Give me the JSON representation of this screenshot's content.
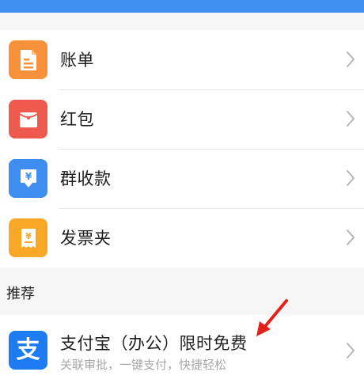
{
  "menu": {
    "items": [
      {
        "label": "账单",
        "icon": "bill-icon",
        "color": "#f7913a"
      },
      {
        "label": "红包",
        "icon": "red-envelope-icon",
        "color": "#ee5a4e"
      },
      {
        "label": "群收款",
        "icon": "group-collect-icon",
        "color": "#3d8ef0"
      },
      {
        "label": "发票夹",
        "icon": "invoice-icon",
        "color": "#f9a825"
      }
    ]
  },
  "recommend": {
    "section_title": "推荐",
    "item": {
      "title": "支付宝（办公）限时免费",
      "subtitle": "关联审批，一键支付，快捷轻松",
      "icon": "alipay-icon",
      "icon_glyph": "支",
      "color": "#1e7cf2"
    }
  },
  "colors": {
    "header_blue": "#3f8ff0",
    "annotation_arrow": "#e5201b"
  }
}
